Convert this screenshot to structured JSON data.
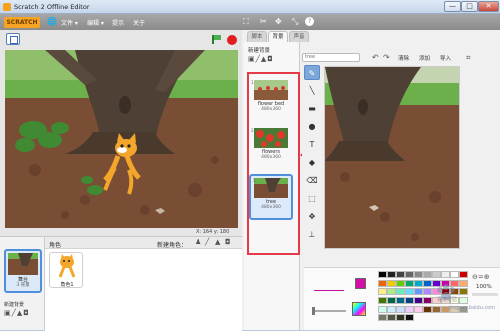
{
  "window": {
    "title": "Scratch 2 Offline Editor",
    "min": "—",
    "max": "□",
    "close": "✕"
  },
  "menubar": {
    "logo": "SCRATCH",
    "globe_icon": "globe-icon",
    "file": "文件 ▾",
    "edit": "编辑 ▾",
    "tips": "提示",
    "about": "关于"
  },
  "stage": {
    "coords": "X: 164   y: 180",
    "colors": {
      "bark": "#5e4a3a",
      "mulch": "#7a4e34",
      "grass": "#6bb04a"
    }
  },
  "sprites": {
    "header": "角色",
    "new_sprite": "新建角色：",
    "stage_label": "舞台",
    "stage_count": "3 背景",
    "new_backdrop": "新建背景",
    "sprite1": "角色1"
  },
  "editor": {
    "tabs": {
      "scripts": "脚本",
      "backdrops": "背景",
      "sounds": "声音"
    },
    "new_backdrop": "新建背景",
    "name_input": "tree",
    "clear": "清除",
    "add": "添加",
    "import": "导入",
    "costumes": [
      {
        "num": "1",
        "name": "flower bed",
        "size": "480x360"
      },
      {
        "num": "2",
        "name": "flowers",
        "size": "480x360"
      },
      {
        "num": "3",
        "name": "tree",
        "size": "480x360"
      }
    ],
    "zoom": "100%",
    "accent": "#e63a49",
    "selected_color": "#d40fa6"
  },
  "watermark": {
    "line1": "百度经验",
    "line2": "jingyan.baidu.com"
  }
}
